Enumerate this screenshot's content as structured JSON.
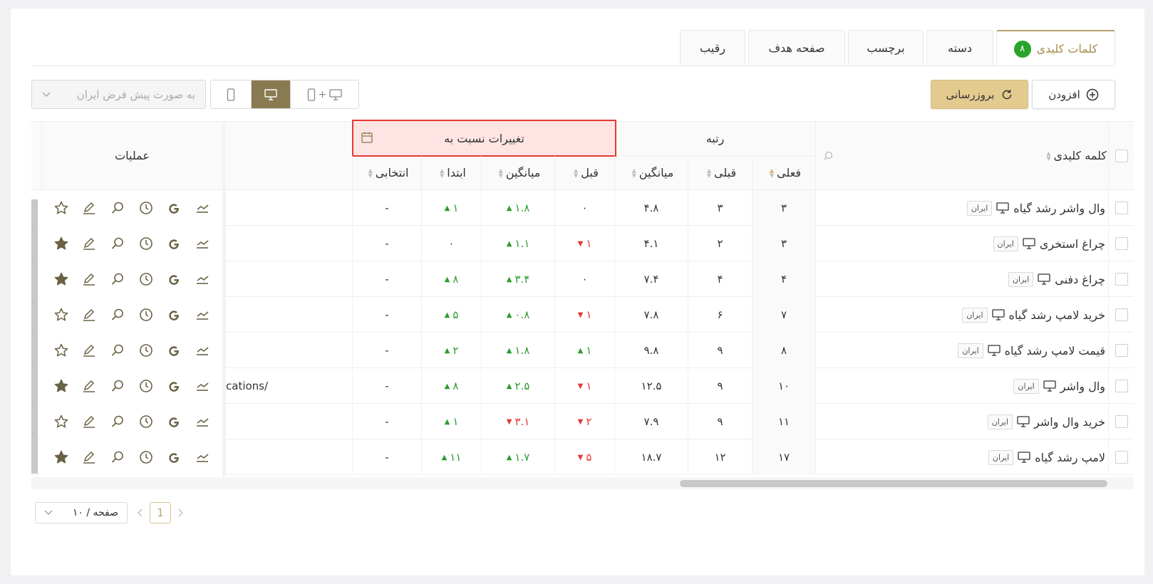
{
  "tabs": [
    {
      "label": "کلمات کلیدی",
      "badge": "۸",
      "active": true
    },
    {
      "label": "دسته"
    },
    {
      "label": "برچسب"
    },
    {
      "label": "صفحه هدف"
    },
    {
      "label": "رقیب"
    }
  ],
  "toolbar": {
    "add_label": "افزودن",
    "refresh_label": "بروزرسانی",
    "device_both_label": "+",
    "region_placeholder": "به صورت پیش فرض ایران"
  },
  "table": {
    "headers": {
      "keyword": "کلمه کلیدی",
      "rank": "رتبه",
      "changes": "تغییرات نسبت به",
      "operations": "عملیات",
      "current": "فعلی",
      "previous": "قبلی",
      "average": "میانگین",
      "before": "قبل",
      "avg_change": "میانگین",
      "start": "ابتدا",
      "selected": "انتخابی"
    },
    "region_tag": "ایران",
    "rows": [
      {
        "keyword": "وال واشر رشد گیاه",
        "current": "۳",
        "previous": "۳",
        "average": "۴.۸",
        "before": "۰",
        "before_dir": "none",
        "avg": "۱.۸",
        "avg_dir": "up",
        "start": "۱",
        "start_dir": "up",
        "selected": "-",
        "fav": false,
        "url": ""
      },
      {
        "keyword": "چراغ استخری",
        "current": "۳",
        "previous": "۲",
        "average": "۴.۱",
        "before": "۱",
        "before_dir": "down",
        "avg": "۱.۱",
        "avg_dir": "up",
        "start": "۰",
        "start_dir": "none",
        "selected": "-",
        "fav": true,
        "url": ""
      },
      {
        "keyword": "چراغ دفنی",
        "current": "۴",
        "previous": "۴",
        "average": "۷.۴",
        "before": "۰",
        "before_dir": "none",
        "avg": "۳.۴",
        "avg_dir": "up",
        "start": "۸",
        "start_dir": "up",
        "selected": "-",
        "fav": true,
        "url": ""
      },
      {
        "keyword": "خرید لامپ رشد گیاه",
        "current": "۷",
        "previous": "۶",
        "average": "۷.۸",
        "before": "۱",
        "before_dir": "down",
        "avg": "۰.۸",
        "avg_dir": "up",
        "start": "۵",
        "start_dir": "up",
        "selected": "-",
        "fav": false,
        "url": ""
      },
      {
        "keyword": "قیمت لامپ رشد گیاه",
        "current": "۸",
        "previous": "۹",
        "average": "۹.۸",
        "before": "۱",
        "before_dir": "up",
        "avg": "۱.۸",
        "avg_dir": "up",
        "start": "۲",
        "start_dir": "up",
        "selected": "-",
        "fav": false,
        "url": ""
      },
      {
        "keyword": "وال واشر",
        "current": "۱۰",
        "previous": "۹",
        "average": "۱۲.۵",
        "before": "۱",
        "before_dir": "down",
        "avg": "۲.۵",
        "avg_dir": "up",
        "start": "۸",
        "start_dir": "up",
        "selected": "-",
        "fav": true,
        "url": "cations/"
      },
      {
        "keyword": "خرید وال واشر",
        "current": "۱۱",
        "previous": "۹",
        "average": "۷.۹",
        "before": "۲",
        "before_dir": "down",
        "avg": "۳.۱",
        "avg_dir": "down",
        "start": "۱",
        "start_dir": "up",
        "selected": "-",
        "fav": false,
        "url": ""
      },
      {
        "keyword": "لامپ رشد گیاه",
        "current": "۱۷",
        "previous": "۱۲",
        "average": "۱۸.۷",
        "before": "۵",
        "before_dir": "down",
        "avg": "۱.۷",
        "avg_dir": "up",
        "start": "۱۱",
        "start_dir": "up",
        "selected": "-",
        "fav": true,
        "url": ""
      }
    ]
  },
  "pagination": {
    "page_size_label": "۱۰ / صفحه",
    "current_page": "1"
  },
  "colors": {
    "accent": "#b3a068",
    "refresh_bg": "#e3ca8f",
    "device_active": "#8a7a52",
    "up": "#2e9c2e",
    "down": "#e53935",
    "icon": "#6b6245"
  },
  "icons": {
    "ops": [
      "chart-icon",
      "google-icon",
      "history-icon",
      "search-icon",
      "edit-icon",
      "star-icon"
    ]
  }
}
